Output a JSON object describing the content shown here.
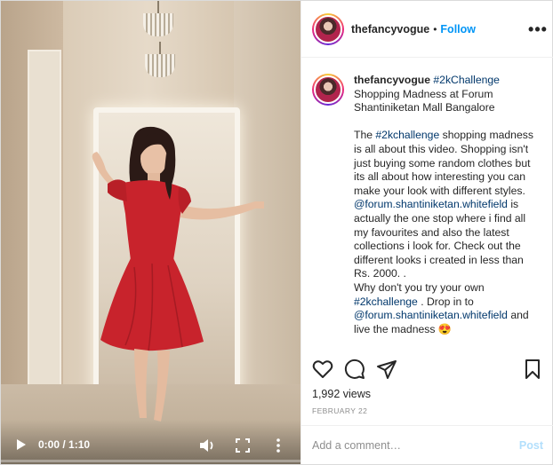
{
  "video": {
    "time": "0:00 / 1:10",
    "progress": 0.0,
    "icons": {
      "play": "play-icon",
      "volume": "volume-icon",
      "fullscreen": "fullscreen-icon",
      "more": "more-vertical-icon"
    }
  },
  "header": {
    "username": "thefancyvogue",
    "separator": "•",
    "follow_label": "Follow",
    "options_label": "•••"
  },
  "caption": {
    "username": "thefancyvogue",
    "hashtag": "#2kChallenge",
    "line1": "Shopping Madness at Forum Shantiniketan Mall Bangalore",
    "body_pre": "The ",
    "body_hashtag": "#2kchallenge",
    "body_text": " shopping madness is all about this video. Shopping isn't just buying some random clothes but its all about how interesting you can make your look with different styles.",
    "mention1": "@forum.shantiniketan.whitefield",
    "mention1_text": " is actually the one stop where i find all my favourites and also the latest collections i look for. Check out the different looks i created in less than Rs. 2000. .",
    "line_why": "Why don't you try your own ",
    "hashtag2": "#2kchallenge",
    "drop_text": " . Drop in to",
    "mention2": "@forum.shantiniketan.whitefield",
    "end_text": " and live the madness 😍"
  },
  "actions": {
    "icons": {
      "like": "heart-icon",
      "comment": "comment-icon",
      "share": "share-icon",
      "save": "bookmark-icon"
    }
  },
  "stats": {
    "views": "1,992 views",
    "date": "FEBRUARY 22"
  },
  "comment": {
    "placeholder": "Add a comment…",
    "post_label": "Post"
  },
  "colors": {
    "link": "#00376b",
    "follow": "#0095f6",
    "post_disabled": "#b2dffc",
    "dress": "#c8232c"
  }
}
